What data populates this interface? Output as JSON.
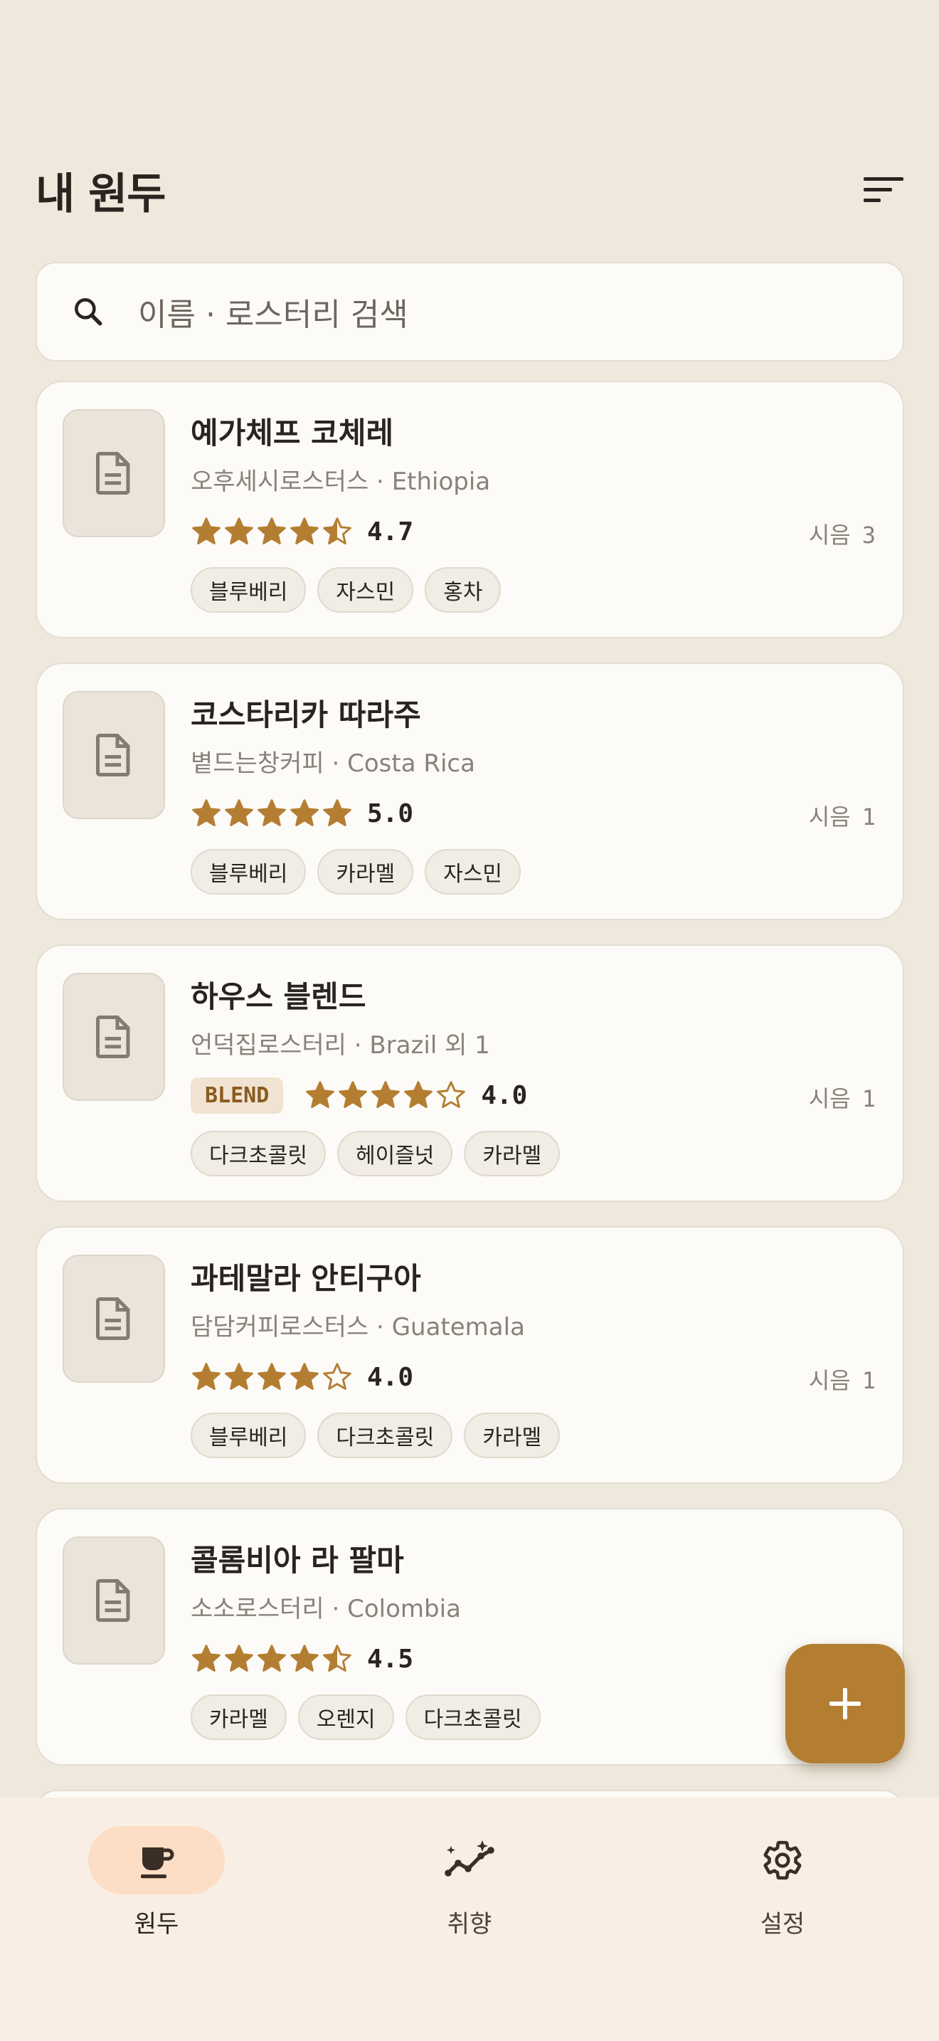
{
  "header": {
    "title": "내 원두"
  },
  "search": {
    "placeholder": "이름 · 로스터리 검색"
  },
  "beans": [
    {
      "name": "예가체프 코체레",
      "roastery": "오후세시로스터스",
      "origin": "Ethiopia",
      "rating": 4.7,
      "rating_text": "4.7",
      "blend": "",
      "tastings_label": "시음",
      "tastings": "3",
      "tags": [
        "블루베리",
        "자스민",
        "홍차"
      ]
    },
    {
      "name": "코스타리카 따라주",
      "roastery": "볕드는창커피",
      "origin": "Costa Rica",
      "rating": 5.0,
      "rating_text": "5.0",
      "blend": "",
      "tastings_label": "시음",
      "tastings": "1",
      "tags": [
        "블루베리",
        "카라멜",
        "자스민"
      ]
    },
    {
      "name": "하우스 블렌드",
      "roastery": "언덕집로스터리",
      "origin": "Brazil 외 1",
      "rating": 4.0,
      "rating_text": "4.0",
      "blend": "BLEND",
      "tastings_label": "시음",
      "tastings": "1",
      "tags": [
        "다크초콜릿",
        "헤이즐넛",
        "카라멜"
      ]
    },
    {
      "name": "과테말라 안티구아",
      "roastery": "담담커피로스터스",
      "origin": "Guatemala",
      "rating": 4.0,
      "rating_text": "4.0",
      "blend": "",
      "tastings_label": "시음",
      "tastings": "1",
      "tags": [
        "블루베리",
        "다크초콜릿",
        "카라멜"
      ]
    },
    {
      "name": "콜롬비아 라 팔마",
      "roastery": "소소로스터리",
      "origin": "Colombia",
      "rating": 4.5,
      "rating_text": "4.5",
      "blend": "",
      "tastings_label": "",
      "tastings": "",
      "tags": [
        "카라멜",
        "오렌지",
        "다크초콜릿"
      ]
    }
  ],
  "fab": {
    "icon": "plus-icon"
  },
  "nav": [
    {
      "label": "원두",
      "icon": "coffee-cup-icon",
      "active": true
    },
    {
      "label": "취향",
      "icon": "taste-chart-icon",
      "active": false
    },
    {
      "label": "설정",
      "icon": "settings-gear-icon",
      "active": false
    }
  ],
  "colors": {
    "background": "#EFE8DD",
    "card": "#FCFBF8",
    "accent": "#B47E32",
    "nav_background": "#F9EEE3",
    "nav_active": "#FCDDC5"
  }
}
